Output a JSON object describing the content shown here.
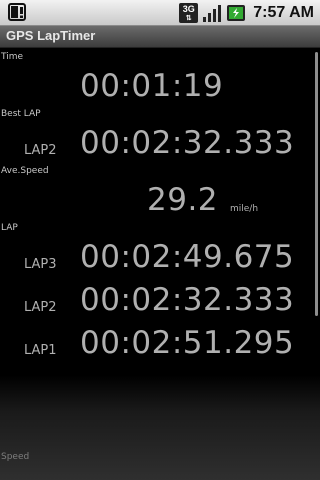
{
  "status": {
    "network_label": "3G",
    "clock": "7:57 AM"
  },
  "app": {
    "title": "GPS LapTimer"
  },
  "time": {
    "label": "Time",
    "value": "00:01:19"
  },
  "best_lap": {
    "label": "Best LAP",
    "lap": "LAP2",
    "value": "00:02:32.333"
  },
  "ave_speed": {
    "label": "Ave.Speed",
    "value": "29.2",
    "unit": "mile/h"
  },
  "laps": {
    "label": "LAP",
    "items": [
      {
        "name": "LAP3",
        "time": "00:02:49.675"
      },
      {
        "name": "LAP2",
        "time": "00:02:32.333"
      },
      {
        "name": "LAP1",
        "time": "00:02:51.295"
      }
    ]
  },
  "speed": {
    "label": "Speed"
  }
}
